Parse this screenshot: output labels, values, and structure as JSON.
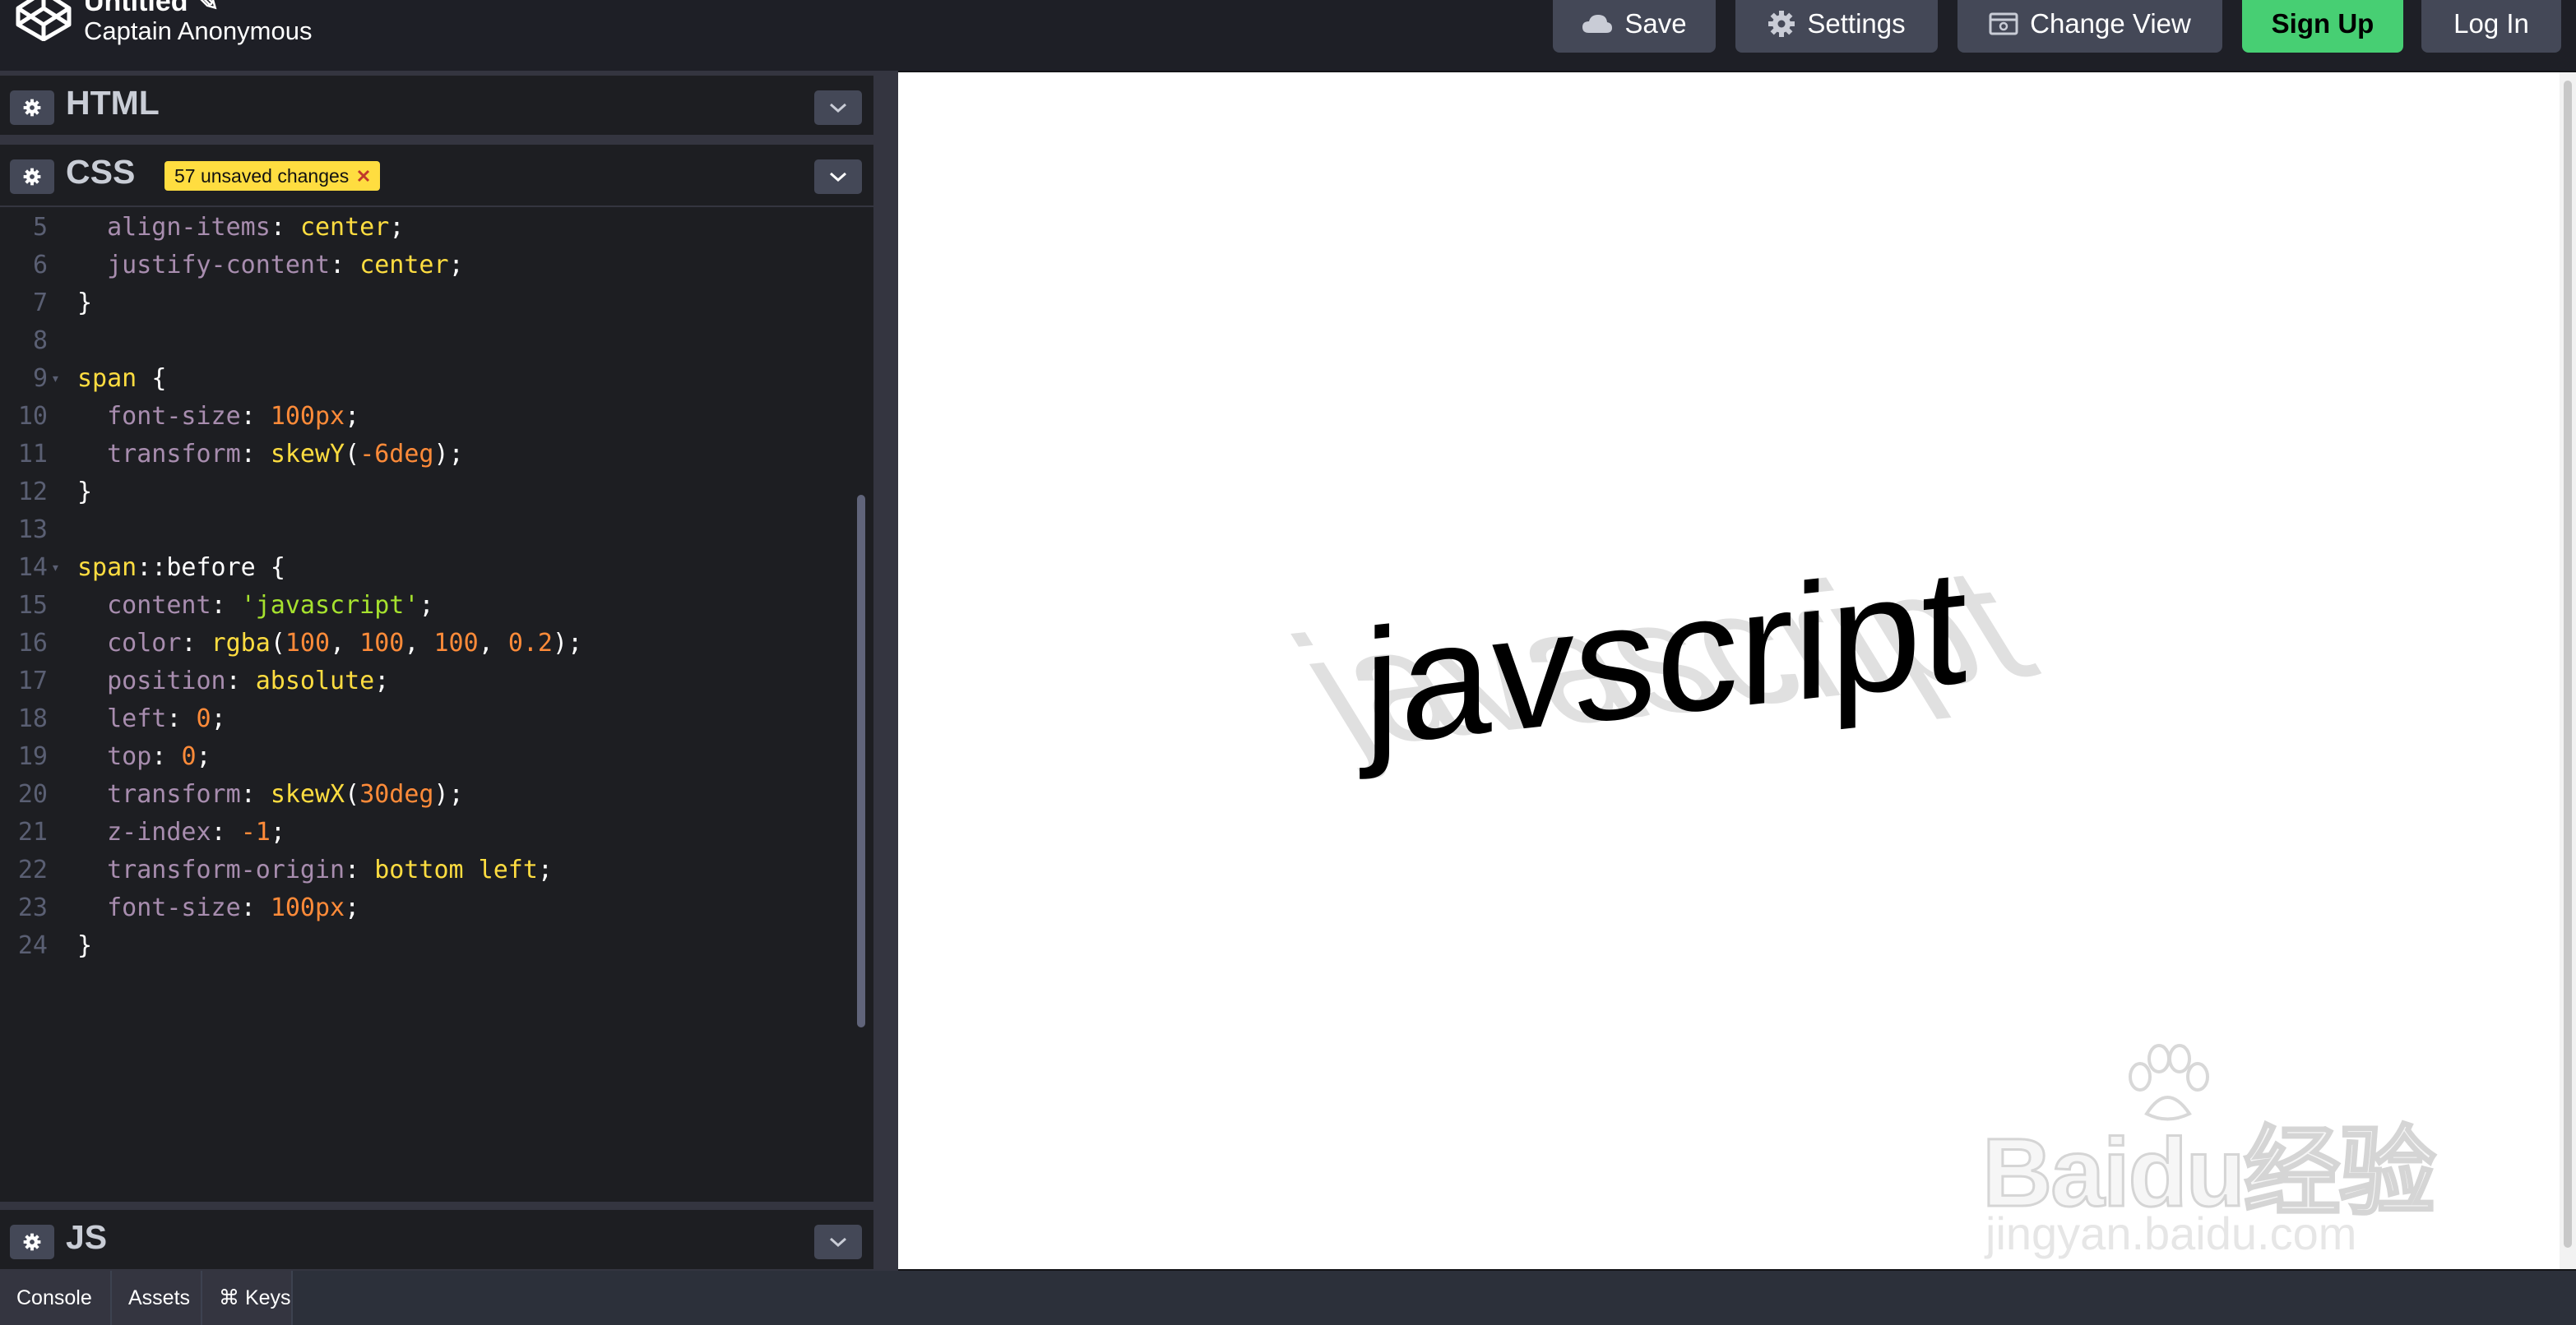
{
  "header": {
    "title": "Untitled",
    "owner": "Captain Anonymous",
    "buttons": {
      "save": "Save",
      "settings": "Settings",
      "change_view": "Change View",
      "sign_up": "Sign Up",
      "log_in": "Log In"
    }
  },
  "panels": {
    "html": {
      "name": "HTML"
    },
    "css": {
      "name": "CSS",
      "badge": "57 unsaved changes"
    },
    "js": {
      "name": "JS"
    }
  },
  "code_lines": [
    {
      "n": "5",
      "text": "  align-items: center;"
    },
    {
      "n": "6",
      "text": "  justify-content: center;"
    },
    {
      "n": "7",
      "text": "}"
    },
    {
      "n": "8",
      "text": ""
    },
    {
      "n": "9",
      "text": "span {"
    },
    {
      "n": "10",
      "text": "  font-size: 100px;"
    },
    {
      "n": "11",
      "text": "  transform: skewY(-6deg);"
    },
    {
      "n": "12",
      "text": "}"
    },
    {
      "n": "13",
      "text": ""
    },
    {
      "n": "14",
      "text": "span::before {"
    },
    {
      "n": "15",
      "text": "  content: 'javascript';"
    },
    {
      "n": "16",
      "text": "  color: rgba(100, 100, 100, 0.2);"
    },
    {
      "n": "17",
      "text": "  position: absolute;"
    },
    {
      "n": "18",
      "text": "  left: 0;"
    },
    {
      "n": "19",
      "text": "  top: 0;"
    },
    {
      "n": "20",
      "text": "  transform: skewX(30deg);"
    },
    {
      "n": "21",
      "text": "  z-index: -1;"
    },
    {
      "n": "22",
      "text": "  transform-origin: bottom left;"
    },
    {
      "n": "23",
      "text": "  font-size: 100px;"
    },
    {
      "n": "24",
      "text": "}"
    }
  ],
  "preview": {
    "word": "javscript",
    "shadow_word": "javascript",
    "watermark_main": "Baidu经验",
    "watermark_sub": "jingyan.baidu.com"
  },
  "footer": {
    "console": "Console",
    "assets": "Assets",
    "keys": "⌘ Keys"
  },
  "colors": {
    "accent_green": "#47cf73",
    "badge_yellow": "#ffdd40",
    "editor_bg": "#1d1e22",
    "header_bg": "#1e1f26"
  }
}
